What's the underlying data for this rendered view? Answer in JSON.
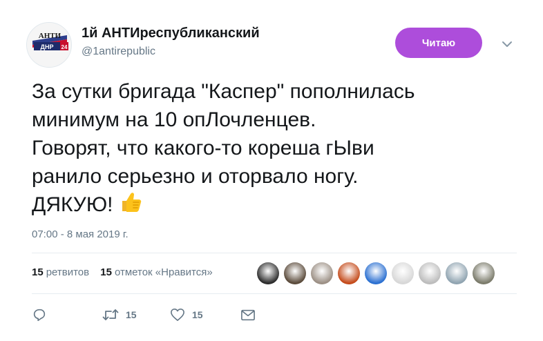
{
  "user": {
    "display_name": "1й АНТИреспубликанский",
    "screen_name": "@1antirepublic",
    "avatar_text_top": "АНТИ",
    "avatar_text_bottom": "ДНР",
    "avatar_badge": "24"
  },
  "follow_button": {
    "label": "Читаю"
  },
  "tweet": {
    "lines": [
      "За сутки бригада \"Каспер\" пополнилась",
      "минимум на 10 опЛочленцев.",
      "Говорят, что какого-то кореша гЫви",
      "ранило серьезно и оторвало ногу.",
      "ДЯКУЮ!"
    ],
    "emoji": "thumbs-up-icon",
    "timestamp": "07:00 - 8 мая 2019 г."
  },
  "stats": {
    "retweets_count": "15",
    "retweets_label": "ретвитов",
    "likes_count": "15",
    "likes_label": "отметок «Нравится»"
  },
  "likers": [
    {
      "name": "liker-avatar-1",
      "color": "#2b2b2b"
    },
    {
      "name": "liker-avatar-2",
      "color": "#5a4a3a"
    },
    {
      "name": "liker-avatar-3",
      "color": "#9b8f84"
    },
    {
      "name": "liker-avatar-4",
      "color": "#c44a1a"
    },
    {
      "name": "liker-avatar-5",
      "color": "#2a6fd1"
    },
    {
      "name": "liker-avatar-6",
      "color": "#d7d7d7"
    },
    {
      "name": "liker-avatar-7",
      "color": "#bcbcbc"
    },
    {
      "name": "liker-avatar-8",
      "color": "#8fa3b0"
    },
    {
      "name": "liker-avatar-9",
      "color": "#7a7a6a"
    }
  ],
  "actions": {
    "retweet_count": "15",
    "like_count": "15"
  },
  "colors": {
    "accent": "#ad4ddb",
    "text": "#14171a",
    "muted": "#657786",
    "divider": "#e6ecf0"
  }
}
